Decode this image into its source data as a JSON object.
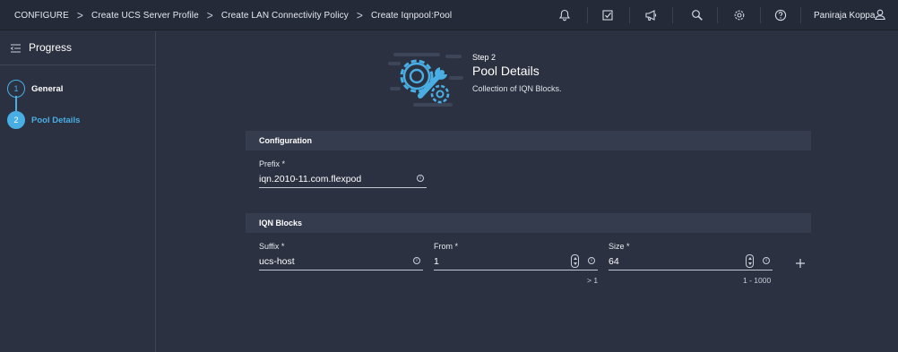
{
  "breadcrumb": {
    "items": [
      "CONFIGURE",
      "Create UCS Server Profile",
      "Create LAN Connectivity Policy",
      "Create Iqnpool:Pool"
    ],
    "separator": ">"
  },
  "header": {
    "icons": [
      "bell-icon",
      "checklist-icon",
      "megaphone-icon",
      "search-icon",
      "gear-icon",
      "help-icon"
    ],
    "user_name": "Paniraja Koppa",
    "user_icon": "user-icon"
  },
  "sidebar": {
    "title": "Progress",
    "steps": [
      {
        "number": "1",
        "label": "General",
        "state": "complete"
      },
      {
        "number": "2",
        "label": "Pool Details",
        "state": "active"
      }
    ]
  },
  "main": {
    "step_number": "Step 2",
    "step_title": "Pool Details",
    "step_subtitle": "Collection of IQN Blocks.",
    "configuration": {
      "heading": "Configuration",
      "prefix_label": "Prefix *",
      "prefix_value": "iqn.2010-11.com.flexpod"
    },
    "iqn_blocks": {
      "heading": "IQN Blocks",
      "suffix_label": "Suffix *",
      "suffix_value": "ucs-host",
      "from_label": "From *",
      "from_value": "1",
      "from_hint": "> 1",
      "size_label": "Size *",
      "size_value": "64",
      "size_hint": "1 - 1000"
    }
  },
  "colors": {
    "accent": "#49aee4",
    "background": "#2b3141",
    "header": "#242a38",
    "section": "#353c4d"
  }
}
